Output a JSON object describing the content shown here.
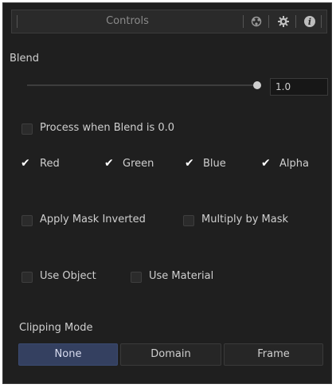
{
  "header": {
    "title": "Controls",
    "icons": [
      "nodes-icon",
      "gear-icon",
      "info-icon"
    ]
  },
  "blend": {
    "label": "Blend",
    "value": "1.0",
    "level": 1.0
  },
  "checkboxes": {
    "process_zero": {
      "label": "Process when Blend is 0.0",
      "checked": false
    },
    "red": {
      "label": "Red",
      "checked": true
    },
    "green": {
      "label": "Green",
      "checked": true
    },
    "blue": {
      "label": "Blue",
      "checked": true
    },
    "alpha": {
      "label": "Alpha",
      "checked": true
    },
    "apply_mask_inverted": {
      "label": "Apply Mask Inverted",
      "checked": false
    },
    "multiply_by_mask": {
      "label": "Multiply by Mask",
      "checked": false
    },
    "use_object": {
      "label": "Use Object",
      "checked": false
    },
    "use_material": {
      "label": "Use Material",
      "checked": false
    }
  },
  "clipping": {
    "label": "Clipping Mode",
    "options": [
      "None",
      "Domain",
      "Frame"
    ],
    "selected": "None"
  },
  "colors": {
    "panel_bg": "#1f1f1f",
    "active_segment": "#344060"
  }
}
